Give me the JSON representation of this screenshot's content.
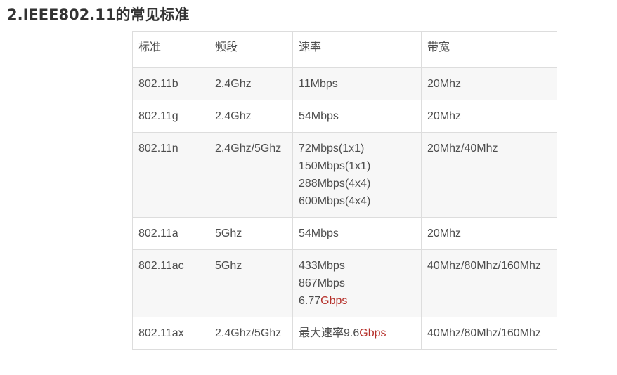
{
  "heading": "2.IEEE802.11的常见标准",
  "accent_color": "#b5302a",
  "table": {
    "headers": [
      "标准",
      "频段",
      "速率",
      "带宽"
    ],
    "rows": [
      {
        "standard": "802.11b",
        "band": "2.4Ghz",
        "rate_lines": [
          [
            "11Mbps",
            ""
          ]
        ],
        "bandwidth": "20Mhz"
      },
      {
        "standard": "802.11g",
        "band": "2.4Ghz",
        "rate_lines": [
          [
            "54Mbps",
            ""
          ]
        ],
        "bandwidth": "20Mhz"
      },
      {
        "standard": "802.11n",
        "band": "2.4Ghz/5Ghz",
        "rate_lines": [
          [
            "72Mbps(1x1)",
            ""
          ],
          [
            "150Mbps(1x1)",
            ""
          ],
          [
            "288Mbps(4x4)",
            ""
          ],
          [
            "600Mbps(4x4)",
            ""
          ]
        ],
        "bandwidth": "20Mhz/40Mhz"
      },
      {
        "standard": "802.11a",
        "band": "5Ghz",
        "rate_lines": [
          [
            "54Mbps",
            ""
          ]
        ],
        "bandwidth": "20Mhz"
      },
      {
        "standard": "802.11ac",
        "band": "5Ghz",
        "rate_lines": [
          [
            "433Mbps",
            ""
          ],
          [
            "867Mbps",
            ""
          ],
          [
            "6.77",
            "Gbps"
          ]
        ],
        "bandwidth": "40Mhz/80Mhz/160Mhz"
      },
      {
        "standard": "802.11ax",
        "band": "2.4Ghz/5Ghz",
        "rate_lines": [
          [
            "最大速率9.6",
            "Gbps"
          ]
        ],
        "bandwidth": "40Mhz/80Mhz/160Mhz"
      }
    ]
  }
}
